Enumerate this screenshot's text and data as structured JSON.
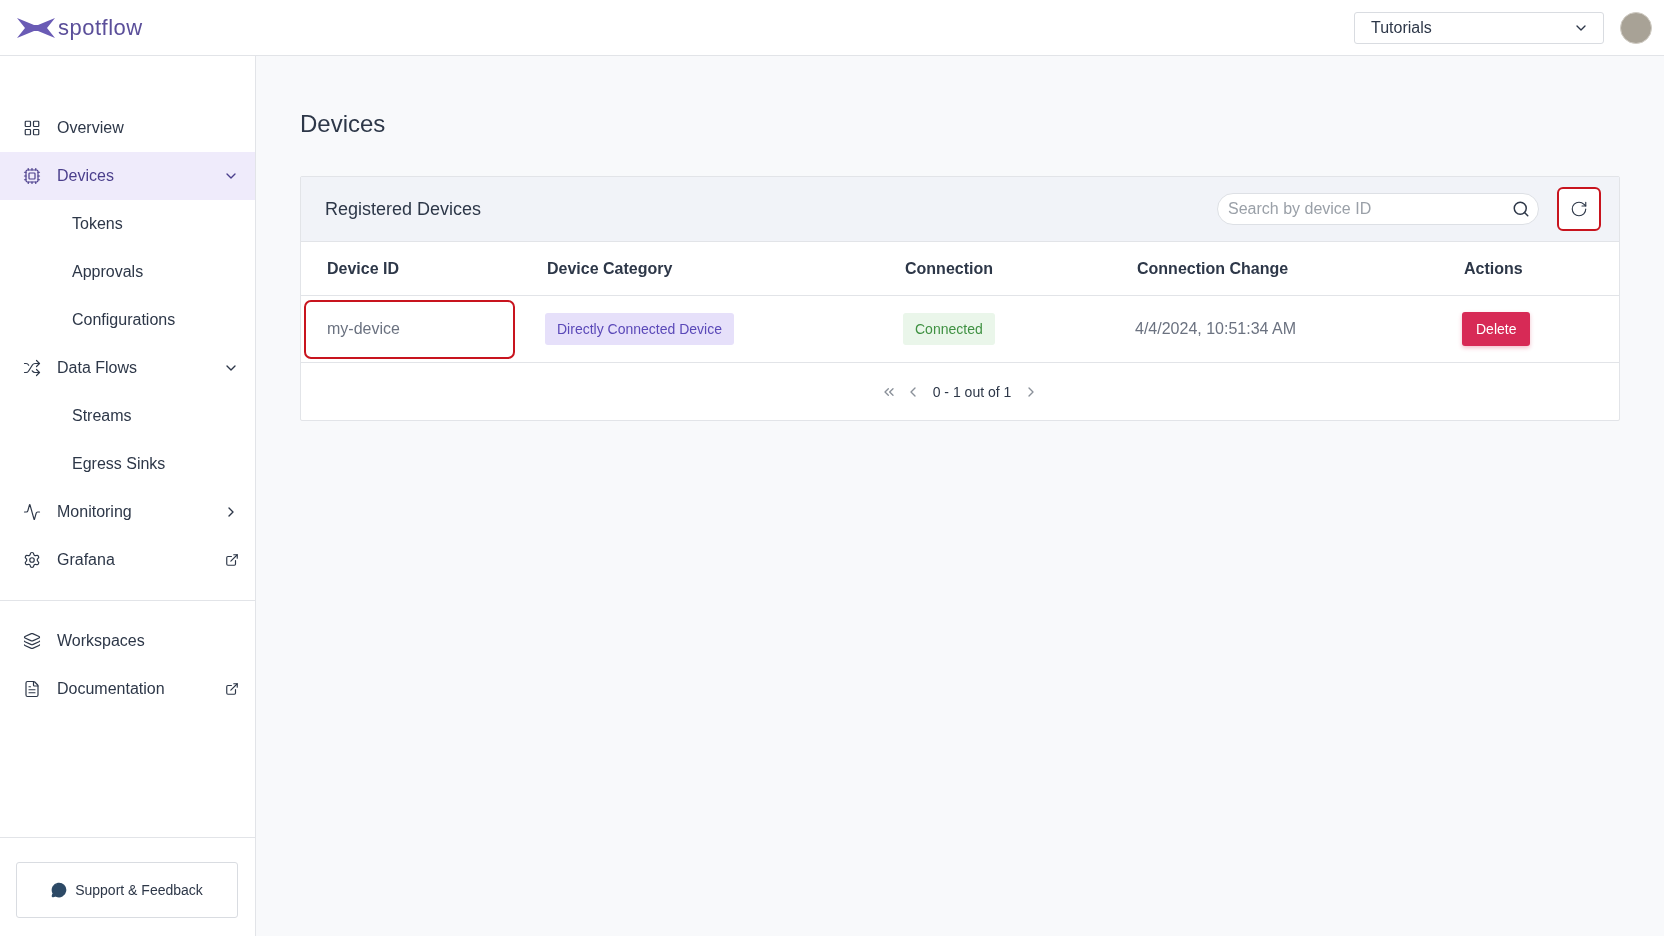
{
  "brand": {
    "name": "spotflow"
  },
  "header": {
    "workspace_select": {
      "value": "Tutorials"
    }
  },
  "sidebar": {
    "items": [
      {
        "label": "Overview",
        "selected": false
      },
      {
        "label": "Devices",
        "selected": true,
        "expanded": true,
        "children": [
          {
            "label": "Tokens",
            "selected": false
          },
          {
            "label": "Approvals",
            "selected": false
          },
          {
            "label": "Configurations",
            "selected": false
          }
        ]
      },
      {
        "label": "Data Flows",
        "selected": false,
        "expanded": true,
        "children": [
          {
            "label": "Streams",
            "selected": false
          },
          {
            "label": "Egress Sinks",
            "selected": false
          }
        ]
      },
      {
        "label": "Monitoring",
        "selected": false,
        "expanded": false
      },
      {
        "label": "Grafana",
        "selected": false,
        "external": true
      }
    ],
    "secondary_items": [
      {
        "label": "Workspaces",
        "selected": false
      },
      {
        "label": "Documentation",
        "selected": false,
        "external": true
      }
    ],
    "support_button": "Support & Feedback"
  },
  "page": {
    "title": "Devices"
  },
  "card": {
    "title": "Registered Devices",
    "search": {
      "placeholder": "Search by device ID"
    },
    "refresh_highlighted": true,
    "table": {
      "columns": [
        "Device ID",
        "Device Category",
        "Connection",
        "Connection Change",
        "Actions"
      ],
      "rows": [
        {
          "device_id": "my-device",
          "highlighted": true,
          "category": "Directly Connected Device",
          "connection": "Connected",
          "connection_change": "4/4/2024, 10:51:34 AM",
          "action": "Delete"
        }
      ]
    },
    "pagination": {
      "range": "0 - 1 out of 1"
    }
  }
}
